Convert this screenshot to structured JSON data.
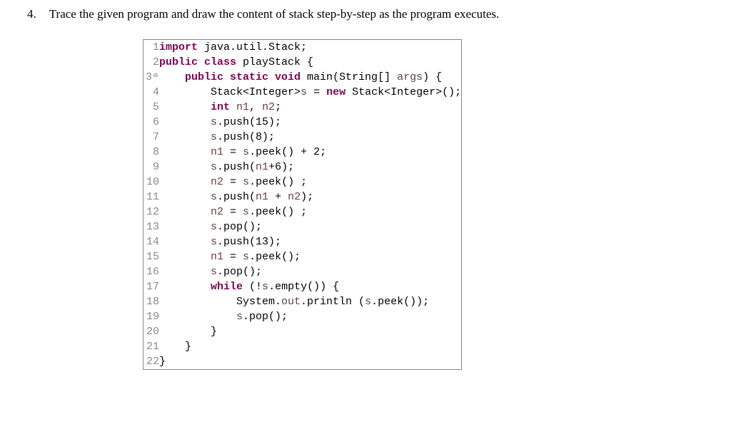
{
  "question": {
    "number": "4.",
    "text": "Trace the given program and draw the content of stack step-by-step as the program executes."
  },
  "code": {
    "lines": [
      {
        "num": "1",
        "tokens": [
          {
            "t": "import ",
            "c": "kw"
          },
          {
            "t": "java.util.Stack;",
            "c": "cls"
          }
        ]
      },
      {
        "num": "2",
        "tokens": [
          {
            "t": "public class ",
            "c": "kw"
          },
          {
            "t": "playStack {",
            "c": "cls"
          }
        ]
      },
      {
        "num": "3",
        "fold": true,
        "tokens": [
          {
            "t": "    ",
            "c": ""
          },
          {
            "t": "public static void ",
            "c": "kw"
          },
          {
            "t": "main(String[] ",
            "c": "cls"
          },
          {
            "t": "args",
            "c": "var"
          },
          {
            "t": ") {",
            "c": "cls"
          }
        ]
      },
      {
        "num": "4",
        "tokens": [
          {
            "t": "        Stack<Integer>",
            "c": "cls"
          },
          {
            "t": "s",
            "c": "var"
          },
          {
            "t": " = ",
            "c": "cls"
          },
          {
            "t": "new ",
            "c": "kw"
          },
          {
            "t": "Stack<Integer>();",
            "c": "cls"
          }
        ]
      },
      {
        "num": "5",
        "tokens": [
          {
            "t": "        ",
            "c": ""
          },
          {
            "t": "int ",
            "c": "kw"
          },
          {
            "t": "n1",
            "c": "var"
          },
          {
            "t": ", ",
            "c": "cls"
          },
          {
            "t": "n2",
            "c": "var"
          },
          {
            "t": ";",
            "c": "cls"
          }
        ]
      },
      {
        "num": "6",
        "tokens": [
          {
            "t": "        ",
            "c": ""
          },
          {
            "t": "s",
            "c": "var"
          },
          {
            "t": ".push(15);",
            "c": "cls"
          }
        ]
      },
      {
        "num": "7",
        "tokens": [
          {
            "t": "        ",
            "c": ""
          },
          {
            "t": "s",
            "c": "var"
          },
          {
            "t": ".push(8);",
            "c": "cls"
          }
        ]
      },
      {
        "num": "8",
        "tokens": [
          {
            "t": "        ",
            "c": ""
          },
          {
            "t": "n1",
            "c": "var"
          },
          {
            "t": " = ",
            "c": "cls"
          },
          {
            "t": "s",
            "c": "var"
          },
          {
            "t": ".peek() + 2;",
            "c": "cls"
          }
        ]
      },
      {
        "num": "9",
        "tokens": [
          {
            "t": "        ",
            "c": ""
          },
          {
            "t": "s",
            "c": "var"
          },
          {
            "t": ".push(",
            "c": "cls"
          },
          {
            "t": "n1",
            "c": "var"
          },
          {
            "t": "+6);",
            "c": "cls"
          }
        ]
      },
      {
        "num": "10",
        "tokens": [
          {
            "t": "        ",
            "c": ""
          },
          {
            "t": "n2",
            "c": "var"
          },
          {
            "t": " = ",
            "c": "cls"
          },
          {
            "t": "s",
            "c": "var"
          },
          {
            "t": ".peek() ;",
            "c": "cls"
          }
        ]
      },
      {
        "num": "11",
        "tokens": [
          {
            "t": "        ",
            "c": ""
          },
          {
            "t": "s",
            "c": "var"
          },
          {
            "t": ".push(",
            "c": "cls"
          },
          {
            "t": "n1",
            "c": "var"
          },
          {
            "t": " + ",
            "c": "cls"
          },
          {
            "t": "n2",
            "c": "var"
          },
          {
            "t": ");",
            "c": "cls"
          }
        ]
      },
      {
        "num": "12",
        "tokens": [
          {
            "t": "        ",
            "c": ""
          },
          {
            "t": "n2",
            "c": "var"
          },
          {
            "t": " = ",
            "c": "cls"
          },
          {
            "t": "s",
            "c": "var"
          },
          {
            "t": ".peek() ;",
            "c": "cls"
          }
        ]
      },
      {
        "num": "13",
        "tokens": [
          {
            "t": "        ",
            "c": ""
          },
          {
            "t": "s",
            "c": "var"
          },
          {
            "t": ".pop();",
            "c": "cls"
          }
        ]
      },
      {
        "num": "14",
        "tokens": [
          {
            "t": "        ",
            "c": ""
          },
          {
            "t": "s",
            "c": "var"
          },
          {
            "t": ".push(13);",
            "c": "cls"
          }
        ]
      },
      {
        "num": "15",
        "tokens": [
          {
            "t": "        ",
            "c": ""
          },
          {
            "t": "n1",
            "c": "var"
          },
          {
            "t": " = ",
            "c": "cls"
          },
          {
            "t": "s",
            "c": "var"
          },
          {
            "t": ".peek();",
            "c": "cls"
          }
        ]
      },
      {
        "num": "16",
        "tokens": [
          {
            "t": "        ",
            "c": ""
          },
          {
            "t": "s",
            "c": "var"
          },
          {
            "t": ".pop();",
            "c": "cls"
          }
        ]
      },
      {
        "num": "17",
        "tokens": [
          {
            "t": "        ",
            "c": ""
          },
          {
            "t": "while ",
            "c": "kw"
          },
          {
            "t": "(!",
            "c": "cls"
          },
          {
            "t": "s",
            "c": "var"
          },
          {
            "t": ".empty()) {",
            "c": "cls"
          }
        ]
      },
      {
        "num": "18",
        "tokens": [
          {
            "t": "            System.",
            "c": "cls"
          },
          {
            "t": "out",
            "c": "var"
          },
          {
            "t": ".println (",
            "c": "cls"
          },
          {
            "t": "s",
            "c": "var"
          },
          {
            "t": ".peek());",
            "c": "cls"
          }
        ]
      },
      {
        "num": "19",
        "tokens": [
          {
            "t": "            ",
            "c": ""
          },
          {
            "t": "s",
            "c": "var"
          },
          {
            "t": ".pop();",
            "c": "cls"
          }
        ]
      },
      {
        "num": "20",
        "tokens": [
          {
            "t": "        }",
            "c": "cls"
          }
        ]
      },
      {
        "num": "21",
        "tokens": [
          {
            "t": "    }",
            "c": "cls"
          }
        ]
      },
      {
        "num": "22",
        "tokens": [
          {
            "t": "}",
            "c": "cls"
          }
        ]
      }
    ]
  }
}
